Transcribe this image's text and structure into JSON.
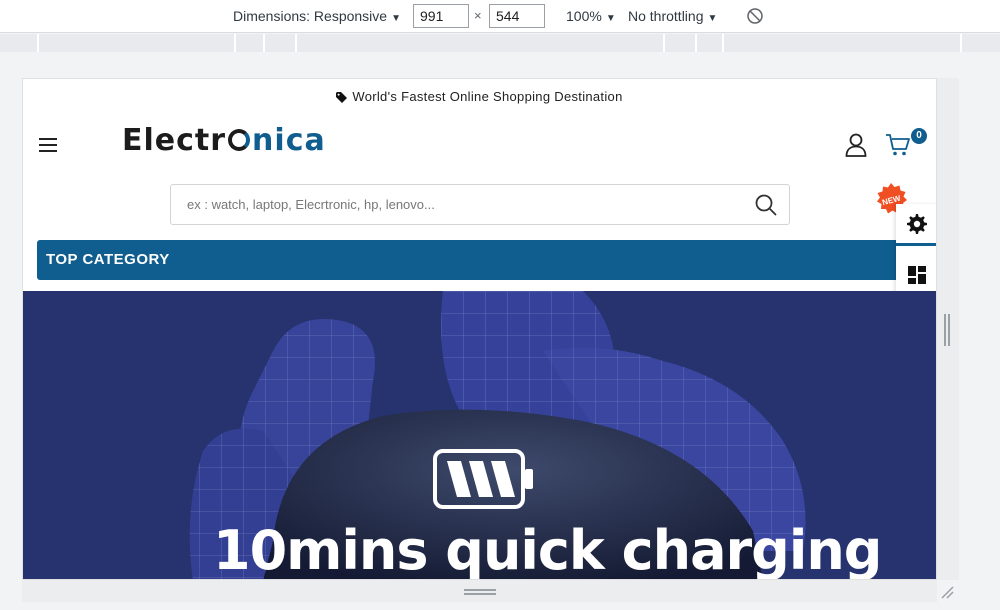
{
  "devtools": {
    "dimensions_label": "Dimensions: Responsive",
    "width_value": "991",
    "height_value": "544",
    "zoom_label": "100%",
    "throttling_label": "No throttling",
    "times_glyph": "×"
  },
  "page": {
    "promo_text": "World's Fastest Online Shopping Destination",
    "logo_prefix": "Electr",
    "logo_suffix": "nica",
    "cart_count": "0",
    "search_placeholder": "ex : watch, laptop, Elecrtronic, hp, lenovo...",
    "new_badge": "NEW",
    "top_category_label": "TOP CATEGORY",
    "banner_headline": "10mins quick charging"
  },
  "colors": {
    "brand_blue": "#105d8f",
    "banner_bg": "#27336e",
    "badge_orange": "#f04e23"
  }
}
